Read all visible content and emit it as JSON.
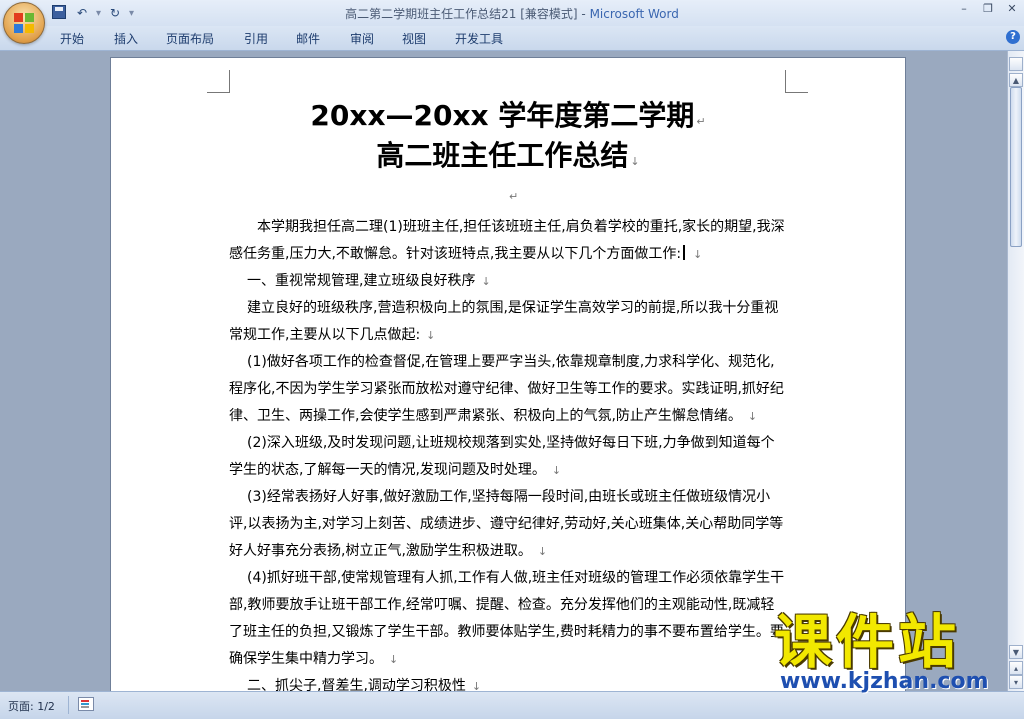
{
  "window": {
    "title": "高二第二学期班主任工作总结21 [兼容模式] - ",
    "app_name": "Microsoft Word"
  },
  "quick_access": {
    "undo": "↶",
    "redo": "↻",
    "dropdown": "▾"
  },
  "window_controls": {
    "minimize": "–",
    "restore": "❐",
    "close": "✕"
  },
  "ribbon": {
    "tabs": [
      "开始",
      "插入",
      "页面布局",
      "引用",
      "邮件",
      "审阅",
      "视图",
      "开发工具"
    ],
    "help": "?"
  },
  "document": {
    "title_line1": "20xx—20xx 学年度第二学期",
    "title_line2": "高二班主任工作总结",
    "paragraphs": [
      "本学期我担任高二理(1)班班主任,担任该班班主任,肩负着学校的重托,家长的期望,我深感任务重,压力大,不敢懈怠。针对该班特点,我主要从以下几个方面做工作:",
      "一、重视常规管理,建立班级良好秩序",
      "建立良好的班级秩序,营造积极向上的氛围,是保证学生高效学习的前提,所以我十分重视常规工作,主要从以下几点做起:",
      "(1)做好各项工作的检查督促,在管理上要严字当头,依靠规章制度,力求科学化、规范化,程序化,不因为学生学习紧张而放松对遵守纪律、做好卫生等工作的要求。实践证明,抓好纪律、卫生、两操工作,会使学生感到严肃紧张、积极向上的气氛,防止产生懈怠情绪。",
      "(2)深入班级,及时发现问题,让班规校规落到实处,坚持做好每日下班,力争做到知道每个学生的状态,了解每一天的情况,发现问题及时处理。",
      "(3)经常表扬好人好事,做好激励工作,坚持每隔一段时间,由班长或班主任做班级情况小评,以表扬为主,对学习上刻苦、成绩进步、遵守纪律好,劳动好,关心班集体,关心帮助同学等好人好事充分表扬,树立正气,激励学生积极进取。",
      "(4)抓好班干部,使常规管理有人抓,工作有人做,班主任对班级的管理工作必须依靠学生干部,教师要放手让班干部工作,经常叮嘱、提醒、检查。充分发挥他们的主观能动性,既减轻了班主任的负担,又锻炼了学生干部。教师要体贴学生,费时耗精力的事不要布置给学生。要确保学生集中精力学习。",
      "二、抓尖子,督差生,调动学习积极性"
    ],
    "para_mark": "↵",
    "line_mark": "↓"
  },
  "statusbar": {
    "page": "页面: 1/2"
  },
  "watermark": {
    "logo": "课件站",
    "url": "www.kjzhan.com"
  }
}
